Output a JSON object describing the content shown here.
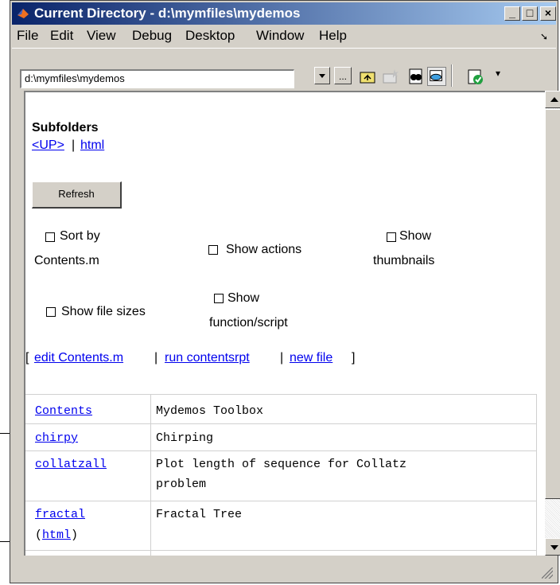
{
  "window": {
    "title": "Current Directory - d:\\mymfiles\\mydemos",
    "controls": {
      "minimize": "_",
      "maximize": "□",
      "close": "×"
    }
  },
  "menu": [
    "File",
    "Edit",
    "View",
    "Debug",
    "Desktop",
    "Window",
    "Help"
  ],
  "toolbar": {
    "address": "d:\\mymfiles\\mydemos",
    "browse_label": "...",
    "icons": [
      "up-folder-icon",
      "new-folder-icon",
      "find-files-icon",
      "view-toggle-icon",
      "checklist-icon"
    ]
  },
  "content": {
    "heading": "Subfolders",
    "up_link": "<UP>",
    "separator": "|",
    "html_link": "html",
    "refresh": "Refresh",
    "options": {
      "sort_line1": "Sort by",
      "sort_line2": "Contents.m",
      "show_actions": "Show actions",
      "thumb_line1": "Show",
      "thumb_line2": "thumbnails",
      "file_sizes": "Show file sizes",
      "func_line1": "Show",
      "func_line2": "function/script"
    },
    "actions": {
      "open": "[",
      "edit": "edit Contents.m",
      "sep1": "|",
      "run": "run contentsrpt",
      "sep2": "|",
      "new": "new file",
      "close": "]"
    },
    "files": [
      {
        "name": "Contents",
        "description": "Mydemos Toolbox"
      },
      {
        "name": "chirpy",
        "description": "Chirping"
      },
      {
        "name": "collatzall",
        "description": "Plot length of sequence for Collatz",
        "description2": "problem"
      },
      {
        "name": "fractal",
        "description": "Fractal Tree",
        "extra_open": "(",
        "extra_link": "html",
        "extra_close": ")"
      }
    ]
  },
  "colors": {
    "titlebar_start": "#0a246a",
    "titlebar_end": "#a6caf0",
    "link": "#0000ee",
    "face": "#d4d0c8"
  }
}
